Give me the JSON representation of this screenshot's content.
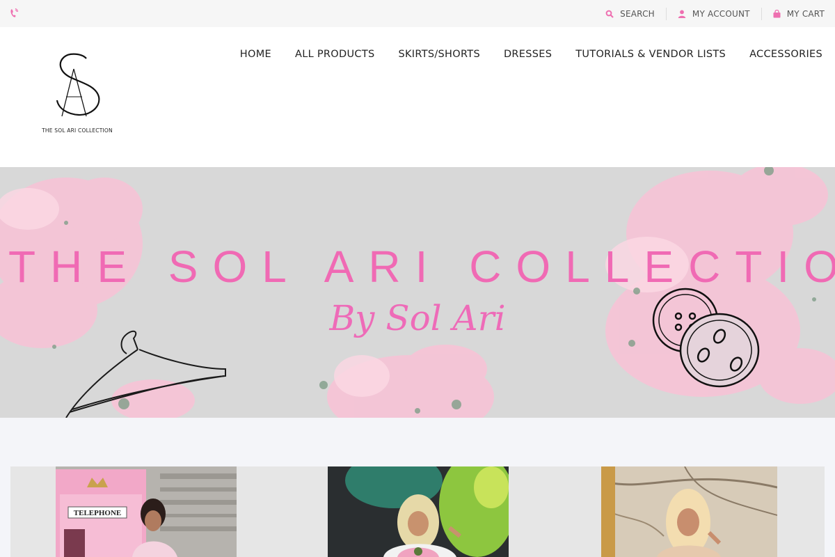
{
  "topbar": {
    "search_label": "SEARCH",
    "account_label": "MY ACCOUNT",
    "cart_label": "MY CART"
  },
  "brand": {
    "logo_monogram": "SA",
    "logo_caption": "THE SOL ARI COLLECTION"
  },
  "nav": {
    "items": [
      "HOME",
      "ALL PRODUCTS",
      "SKIRTS/SHORTS",
      "DRESSES",
      "TUTORIALS & VENDOR LISTS",
      "ACCESSORIES"
    ]
  },
  "hero": {
    "title": "THE SOL ARI COLLECTION",
    "subtitle": "By Sol Ari"
  },
  "products": {
    "first_booth_sign": "TELEPHONE"
  },
  "colors": {
    "accent": "#f06ab4",
    "topbar_bg": "#f6f6f6",
    "hero_bg": "#d8d8d8",
    "page_bg": "#f4f5f9"
  },
  "icons": [
    "phone-icon",
    "search-icon",
    "user-icon",
    "cart-icon",
    "hanger-icon",
    "buttons-icon"
  ]
}
